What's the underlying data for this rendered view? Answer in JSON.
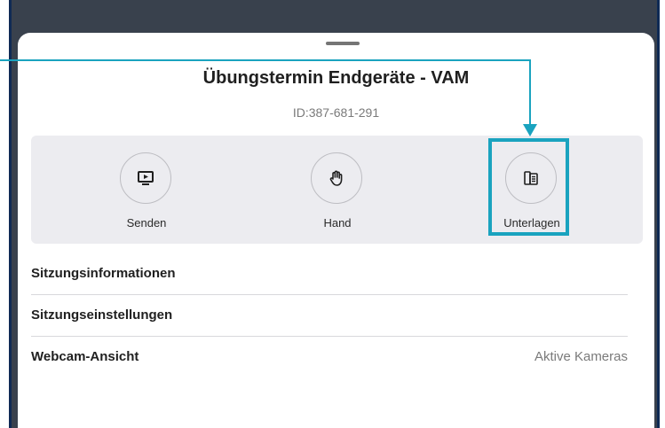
{
  "header": {
    "title": "Übungstermin Endgeräte - VAM",
    "meeting_id": "ID:387-681-291"
  },
  "actions": [
    {
      "label": "Senden",
      "icon": "share-screen-icon"
    },
    {
      "label": "Hand",
      "icon": "raise-hand-icon"
    },
    {
      "label": "Unterlagen",
      "icon": "documents-icon"
    }
  ],
  "menu": {
    "items": [
      {
        "label": "Sitzungsinformationen",
        "value": ""
      },
      {
        "label": "Sitzungseinstellungen",
        "value": ""
      },
      {
        "label": "Webcam-Ansicht",
        "value": "Aktive Kameras"
      }
    ]
  },
  "colors": {
    "accent": "#1aa3bf",
    "backdrop": "#39414d",
    "panel": "#ececf0"
  }
}
